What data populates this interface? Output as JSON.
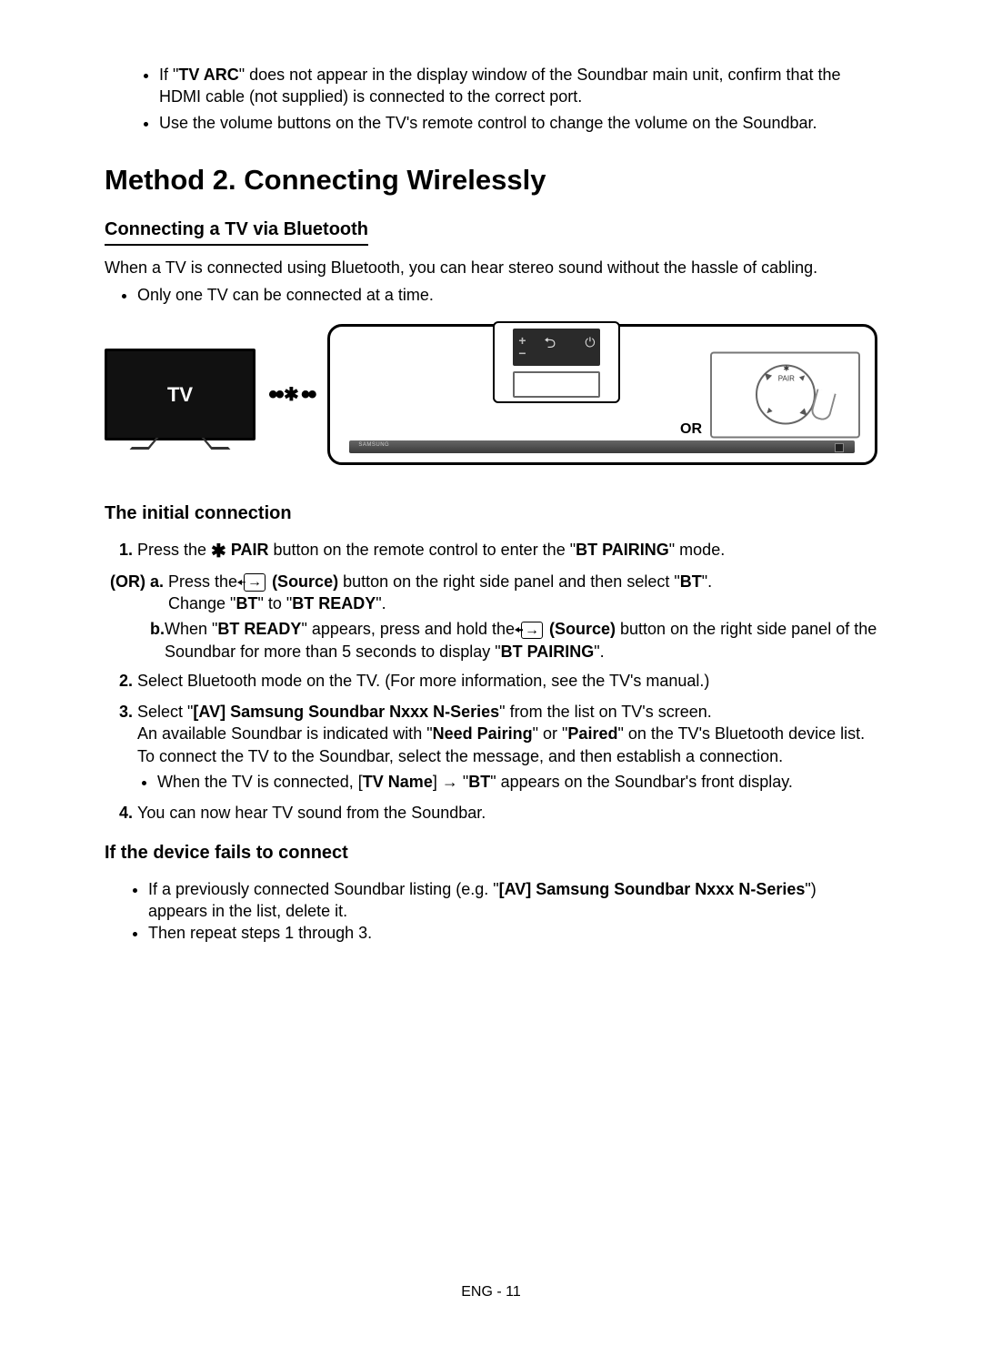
{
  "top_bullets": [
    {
      "prefix": "If \"",
      "bold": "TV ARC",
      "suffix": "\" does not appear in the display window of the Soundbar main unit, confirm that the HDMI cable (not supplied) is connected to the correct port."
    },
    {
      "text": "Use the volume buttons on the TV's remote control to change the volume on the Soundbar."
    }
  ],
  "method_heading": "Method 2. Connecting Wirelessly",
  "subheading": "Connecting a TV via Bluetooth",
  "intro_line": "When a TV is connected using Bluetooth, you can hear stereo sound without the hassle of cabling.",
  "note_bullet": "Only one TV can be connected at a time.",
  "diagram": {
    "tv_label": "TV",
    "or_label": "OR"
  },
  "section_initial": "The initial connection",
  "step1": {
    "a": "Press the ",
    "pair_icon_label": "PAIR",
    "b": " button on the remote control to enter the \"",
    "bold1": "BT PAIRING",
    "c": "\" mode."
  },
  "or_label": "(OR)",
  "or_a": {
    "letter": "a.",
    "t1": "Press the ",
    "src_label": "(Source)",
    "t2": " button on the right side panel and then select \"",
    "bold1": "BT",
    "t3": "\".",
    "line2_a": "Change \"",
    "line2_b1": "BT",
    "line2_b": "\" to \"",
    "line2_b2": "BT READY",
    "line2_c": "\"."
  },
  "or_b": {
    "letter": "b.",
    "t1": "When \"",
    "bold1": "BT READY",
    "t2": "\" appears, press and hold the ",
    "src_label": "(Source)",
    "t3": " button on the right side panel of the Soundbar for more than 5 seconds to display \"",
    "bold2": "BT PAIRING",
    "t4": "\"."
  },
  "step2": "Select Bluetooth mode on the TV. (For more information, see the TV's manual.)",
  "step3": {
    "t1": "Select \"",
    "bold1": "[AV] Samsung Soundbar Nxxx N-Series",
    "t2": "\" from the list on TV's screen.",
    "line2a": "An available Soundbar is indicated with \"",
    "line2b1": "Need Pairing",
    "line2b": "\" or \"",
    "line2b2": "Paired",
    "line2c": "\" on the TV's Bluetooth device list. To connect the TV to the Soundbar, select the message, and then establish a connection.",
    "sub_bullet_a": "When the TV is connected, [",
    "sub_bullet_b1": "TV Name",
    "sub_bullet_b": "] → \"",
    "sub_bullet_b2": "BT",
    "sub_bullet_c": "\" appears on the Soundbar's front display."
  },
  "step4": "You can now hear TV sound from the Soundbar.",
  "section_fail": "If the device fails to connect",
  "fail_bullets": {
    "b1a": "If a previously connected Soundbar listing (e.g. \"",
    "b1bold": "[AV] Samsung Soundbar Nxxx N-Series",
    "b1b": "\") appears in the list, delete it.",
    "b2": "Then repeat steps 1 through 3."
  },
  "footer": "ENG - 11"
}
